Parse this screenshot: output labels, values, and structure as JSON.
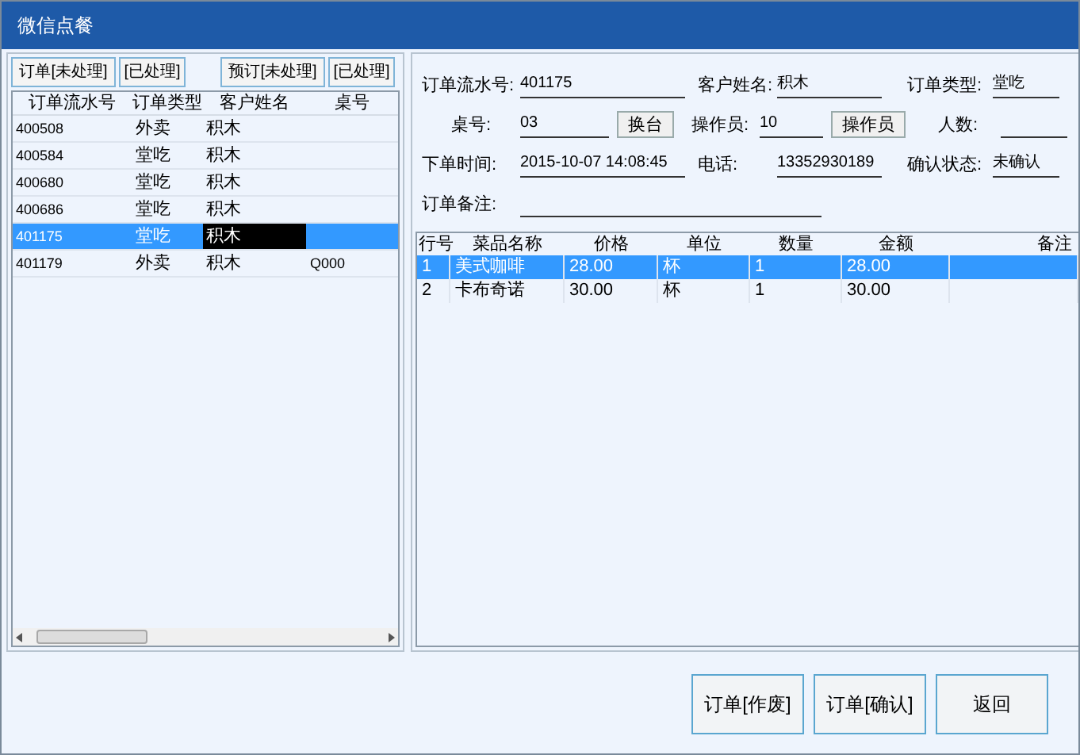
{
  "window": {
    "title": "微信点餐"
  },
  "filter_buttons": [
    "订单[未处理]",
    "[已处理]",
    "预订[未处理]",
    "[已处理]"
  ],
  "order_list": {
    "columns": [
      "订单流水号",
      "订单类型",
      "客户姓名",
      "桌号"
    ],
    "rows": [
      {
        "serial": "400508",
        "type": "外卖",
        "name": "积木",
        "selected": false,
        "name_focused": false
      },
      {
        "serial": "400584",
        "type": "堂吃",
        "name": "积木",
        "selected": false,
        "name_focused": false
      },
      {
        "serial": "400680",
        "type": "堂吃",
        "name": "积木",
        "selected": false,
        "name_focused": false
      },
      {
        "serial": "400686",
        "type": "堂吃",
        "name": "积木",
        "selected": false,
        "name_focused": false
      },
      {
        "serial": "401175",
        "type": "堂吃",
        "name": "积木",
        "selected": true,
        "name_focused": true
      },
      {
        "serial": "401179",
        "type": "外卖",
        "name": "积木",
        "table": "Q000",
        "selected": false,
        "name_focused": false
      }
    ]
  },
  "form": {
    "rows": [
      [
        {
          "label": "订单流水号:",
          "value": "401175"
        },
        {
          "label": "客户姓名:",
          "value": "积木"
        },
        {
          "label": "订单类型:",
          "value": "堂吃"
        }
      ],
      [
        {
          "label": "桌号:",
          "value": "03",
          "button": "换台"
        },
        {
          "label": "操作员:",
          "value": "10",
          "button": "操作员"
        },
        {
          "label": "人数:"
        }
      ],
      [
        {
          "label": "下单时间:",
          "value": "2015-10-07 14:08:45"
        },
        {
          "label": "电话:",
          "value": "13352930189"
        },
        {
          "label": "确认状态:",
          "value": "未确认"
        }
      ],
      [
        {
          "label": "订单备注:"
        }
      ]
    ]
  },
  "items": {
    "columns": [
      "行号",
      "菜品名称",
      "价格",
      "单位",
      "数量",
      "金额",
      "备注"
    ],
    "rows": [
      {
        "cells": [
          "1",
          "美式咖啡",
          "28.00",
          "杯",
          "1",
          "28.00"
        ],
        "selected": true
      },
      {
        "cells": [
          "2",
          "卡布奇诺",
          "30.00",
          "杯",
          "1",
          "30.00"
        ],
        "selected": false
      }
    ]
  },
  "actions": [
    "订单[作废]",
    "订单[确认]",
    "返回"
  ]
}
